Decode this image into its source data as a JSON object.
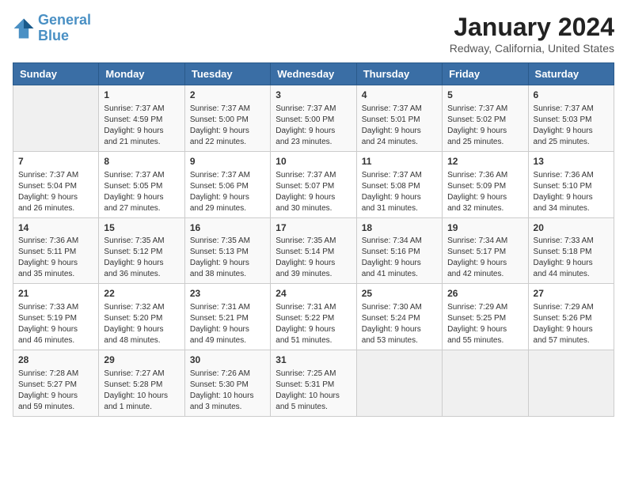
{
  "logo": {
    "line1": "General",
    "line2": "Blue"
  },
  "title": "January 2024",
  "subtitle": "Redway, California, United States",
  "days_of_week": [
    "Sunday",
    "Monday",
    "Tuesday",
    "Wednesday",
    "Thursday",
    "Friday",
    "Saturday"
  ],
  "weeks": [
    [
      {
        "day": "",
        "info": ""
      },
      {
        "day": "1",
        "info": "Sunrise: 7:37 AM\nSunset: 4:59 PM\nDaylight: 9 hours\nand 21 minutes."
      },
      {
        "day": "2",
        "info": "Sunrise: 7:37 AM\nSunset: 5:00 PM\nDaylight: 9 hours\nand 22 minutes."
      },
      {
        "day": "3",
        "info": "Sunrise: 7:37 AM\nSunset: 5:00 PM\nDaylight: 9 hours\nand 23 minutes."
      },
      {
        "day": "4",
        "info": "Sunrise: 7:37 AM\nSunset: 5:01 PM\nDaylight: 9 hours\nand 24 minutes."
      },
      {
        "day": "5",
        "info": "Sunrise: 7:37 AM\nSunset: 5:02 PM\nDaylight: 9 hours\nand 25 minutes."
      },
      {
        "day": "6",
        "info": "Sunrise: 7:37 AM\nSunset: 5:03 PM\nDaylight: 9 hours\nand 25 minutes."
      }
    ],
    [
      {
        "day": "7",
        "info": "Sunrise: 7:37 AM\nSunset: 5:04 PM\nDaylight: 9 hours\nand 26 minutes."
      },
      {
        "day": "8",
        "info": "Sunrise: 7:37 AM\nSunset: 5:05 PM\nDaylight: 9 hours\nand 27 minutes."
      },
      {
        "day": "9",
        "info": "Sunrise: 7:37 AM\nSunset: 5:06 PM\nDaylight: 9 hours\nand 29 minutes."
      },
      {
        "day": "10",
        "info": "Sunrise: 7:37 AM\nSunset: 5:07 PM\nDaylight: 9 hours\nand 30 minutes."
      },
      {
        "day": "11",
        "info": "Sunrise: 7:37 AM\nSunset: 5:08 PM\nDaylight: 9 hours\nand 31 minutes."
      },
      {
        "day": "12",
        "info": "Sunrise: 7:36 AM\nSunset: 5:09 PM\nDaylight: 9 hours\nand 32 minutes."
      },
      {
        "day": "13",
        "info": "Sunrise: 7:36 AM\nSunset: 5:10 PM\nDaylight: 9 hours\nand 34 minutes."
      }
    ],
    [
      {
        "day": "14",
        "info": "Sunrise: 7:36 AM\nSunset: 5:11 PM\nDaylight: 9 hours\nand 35 minutes."
      },
      {
        "day": "15",
        "info": "Sunrise: 7:35 AM\nSunset: 5:12 PM\nDaylight: 9 hours\nand 36 minutes."
      },
      {
        "day": "16",
        "info": "Sunrise: 7:35 AM\nSunset: 5:13 PM\nDaylight: 9 hours\nand 38 minutes."
      },
      {
        "day": "17",
        "info": "Sunrise: 7:35 AM\nSunset: 5:14 PM\nDaylight: 9 hours\nand 39 minutes."
      },
      {
        "day": "18",
        "info": "Sunrise: 7:34 AM\nSunset: 5:16 PM\nDaylight: 9 hours\nand 41 minutes."
      },
      {
        "day": "19",
        "info": "Sunrise: 7:34 AM\nSunset: 5:17 PM\nDaylight: 9 hours\nand 42 minutes."
      },
      {
        "day": "20",
        "info": "Sunrise: 7:33 AM\nSunset: 5:18 PM\nDaylight: 9 hours\nand 44 minutes."
      }
    ],
    [
      {
        "day": "21",
        "info": "Sunrise: 7:33 AM\nSunset: 5:19 PM\nDaylight: 9 hours\nand 46 minutes."
      },
      {
        "day": "22",
        "info": "Sunrise: 7:32 AM\nSunset: 5:20 PM\nDaylight: 9 hours\nand 48 minutes."
      },
      {
        "day": "23",
        "info": "Sunrise: 7:31 AM\nSunset: 5:21 PM\nDaylight: 9 hours\nand 49 minutes."
      },
      {
        "day": "24",
        "info": "Sunrise: 7:31 AM\nSunset: 5:22 PM\nDaylight: 9 hours\nand 51 minutes."
      },
      {
        "day": "25",
        "info": "Sunrise: 7:30 AM\nSunset: 5:24 PM\nDaylight: 9 hours\nand 53 minutes."
      },
      {
        "day": "26",
        "info": "Sunrise: 7:29 AM\nSunset: 5:25 PM\nDaylight: 9 hours\nand 55 minutes."
      },
      {
        "day": "27",
        "info": "Sunrise: 7:29 AM\nSunset: 5:26 PM\nDaylight: 9 hours\nand 57 minutes."
      }
    ],
    [
      {
        "day": "28",
        "info": "Sunrise: 7:28 AM\nSunset: 5:27 PM\nDaylight: 9 hours\nand 59 minutes."
      },
      {
        "day": "29",
        "info": "Sunrise: 7:27 AM\nSunset: 5:28 PM\nDaylight: 10 hours\nand 1 minute."
      },
      {
        "day": "30",
        "info": "Sunrise: 7:26 AM\nSunset: 5:30 PM\nDaylight: 10 hours\nand 3 minutes."
      },
      {
        "day": "31",
        "info": "Sunrise: 7:25 AM\nSunset: 5:31 PM\nDaylight: 10 hours\nand 5 minutes."
      },
      {
        "day": "",
        "info": ""
      },
      {
        "day": "",
        "info": ""
      },
      {
        "day": "",
        "info": ""
      }
    ]
  ]
}
